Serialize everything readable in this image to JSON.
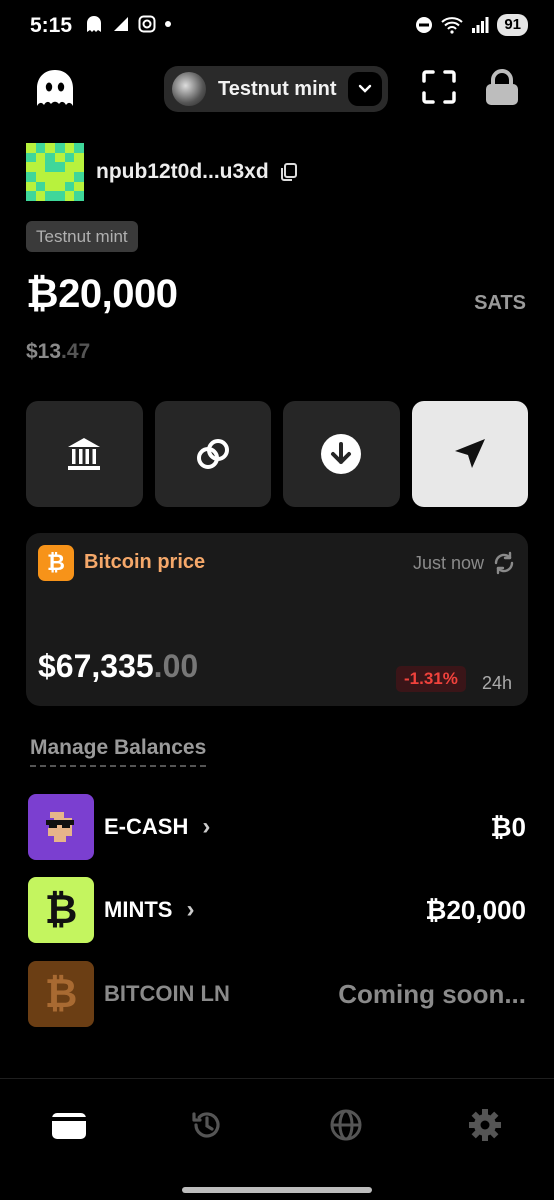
{
  "status_bar": {
    "time": "5:15",
    "battery": "91"
  },
  "header": {
    "mint_selector_label": "Testnut mint"
  },
  "profile": {
    "npub": "npub12t0d...u3xd"
  },
  "mint_badge": "Testnut mint",
  "balance": {
    "amount": "₿20,000",
    "unit": "SATS",
    "fiat_main": "$13",
    "fiat_decimal": ".47"
  },
  "actions": [
    {
      "icon": "bank-icon"
    },
    {
      "icon": "link-icon"
    },
    {
      "icon": "receive-icon"
    },
    {
      "icon": "send-icon"
    }
  ],
  "price_card": {
    "title": "Bitcoin price",
    "updated": "Just now",
    "price_main": "$67,335",
    "price_decimal": ".00",
    "change": "-1.31%",
    "period": "24h",
    "colors": {
      "accent": "#f79319",
      "negative": "#f0423c"
    }
  },
  "manage_balances": {
    "title": "Manage Balances",
    "rows": [
      {
        "label": "E-CASH",
        "chevron": "›",
        "value": "₿0",
        "icon": "cashew-icon"
      },
      {
        "label": "MINTS",
        "chevron": "›",
        "value": "₿20,000",
        "icon": "bitcoin-b-icon"
      },
      {
        "label": "BITCOIN LN",
        "value": "Coming soon...",
        "icon": "bitcoin-b-icon"
      }
    ]
  },
  "bottom_nav": [
    {
      "icon": "wallet-icon",
      "active": true
    },
    {
      "icon": "history-icon",
      "active": false
    },
    {
      "icon": "globe-icon",
      "active": false
    },
    {
      "icon": "gear-icon",
      "active": false
    }
  ]
}
